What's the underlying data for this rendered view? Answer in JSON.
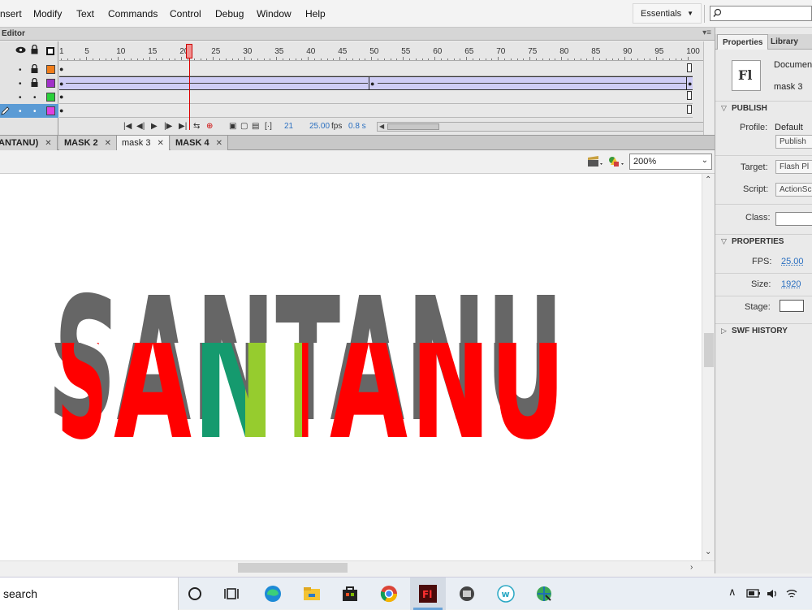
{
  "menu": {
    "items": [
      "nsert",
      "Modify",
      "Text",
      "Commands",
      "Control",
      "Debug",
      "Window",
      "Help"
    ],
    "workspace": "Essentials"
  },
  "timeline": {
    "title": "Editor",
    "ticks": [
      "1",
      "5",
      "10",
      "15",
      "20",
      "25",
      "30",
      "35",
      "40",
      "45",
      "50",
      "55",
      "60",
      "65",
      "70",
      "75",
      "80",
      "85",
      "90",
      "95",
      "100"
    ],
    "layer_colors": [
      "#f07d1a",
      "#a030c8",
      "#2ad03a",
      "#e040e0"
    ],
    "current_frame": "21",
    "fps": "25.00",
    "fps_unit": "fps",
    "time": "0.8 s"
  },
  "tabs": [
    {
      "label": "ANTANU)",
      "active": false
    },
    {
      "label": "MASK 2",
      "active": false
    },
    {
      "label": "mask 3",
      "active": true
    },
    {
      "label": "MASK 4",
      "active": false
    }
  ],
  "editbar": {
    "zoom": "200%"
  },
  "stage": {
    "back_text": "SANTANU",
    "front_letters": [
      "S",
      "A",
      "N",
      "T",
      "A",
      "N",
      "U"
    ],
    "colors": {
      "shadow": "#666666",
      "red": "#ff0000",
      "green": "#159a6e",
      "lime": "#96cc2e"
    }
  },
  "properties": {
    "tabs": [
      "Properties",
      "Library"
    ],
    "doc_label": "Document",
    "doc_name": "mask 3",
    "publish_section": "PUBLISH",
    "profile_label": "Profile:",
    "profile_value": "Default",
    "publish_button": "Publish",
    "target_label": "Target:",
    "target_value": "Flash Pl",
    "script_label": "Script:",
    "script_value": "ActionSc",
    "class_label": "Class:",
    "properties_section": "PROPERTIES",
    "fps_label": "FPS:",
    "fps_value": "25.00",
    "size_label": "Size:",
    "size_value": "1920",
    "stage_label": "Stage:",
    "swf_section": "SWF HISTORY"
  },
  "taskbar": {
    "search_text": "search"
  }
}
